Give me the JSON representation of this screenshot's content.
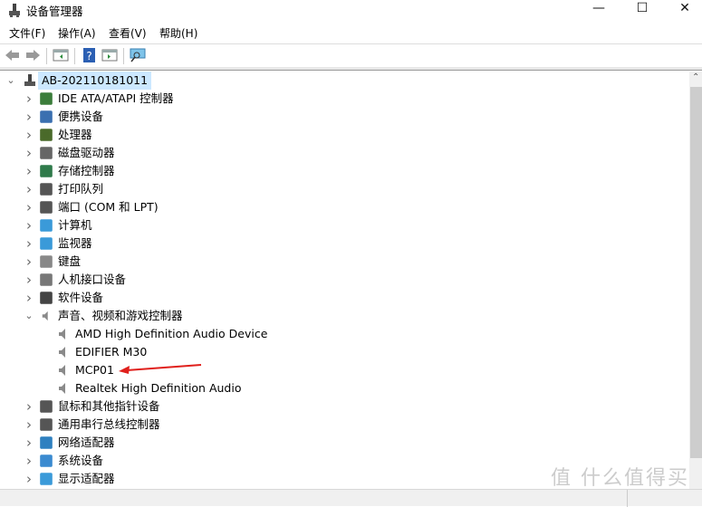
{
  "window": {
    "title": "设备管理器",
    "minimize": "—",
    "maximize": "☐",
    "close": "✕"
  },
  "menu": [
    "文件(F)",
    "操作(A)",
    "查看(V)",
    "帮助(H)"
  ],
  "toolbar": [
    "back-icon",
    "forward-icon",
    "show-hide-console-tree-icon",
    "help-icon",
    "action-pane-icon",
    "scan-hardware-icon"
  ],
  "tree": {
    "root": "AB-202110181011",
    "categories": [
      {
        "label": "IDE ATA/ATAPI 控制器",
        "icon": "ide-controller-icon"
      },
      {
        "label": "便携设备",
        "icon": "portable-device-icon"
      },
      {
        "label": "处理器",
        "icon": "processor-icon"
      },
      {
        "label": "磁盘驱动器",
        "icon": "disk-drive-icon"
      },
      {
        "label": "存储控制器",
        "icon": "storage-controller-icon"
      },
      {
        "label": "打印队列",
        "icon": "printer-icon"
      },
      {
        "label": "端口 (COM 和 LPT)",
        "icon": "port-icon"
      },
      {
        "label": "计算机",
        "icon": "computer-icon"
      },
      {
        "label": "监视器",
        "icon": "monitor-icon"
      },
      {
        "label": "键盘",
        "icon": "keyboard-icon"
      },
      {
        "label": "人机接口设备",
        "icon": "hid-icon"
      },
      {
        "label": "软件设备",
        "icon": "software-device-icon"
      },
      {
        "label": "声音、视频和游戏控制器",
        "icon": "speaker-icon",
        "expanded": true,
        "children": [
          "AMD High Definition Audio Device",
          "EDIFIER M30",
          "MCP01",
          "Realtek High Definition Audio"
        ]
      },
      {
        "label": "鼠标和其他指针设备",
        "icon": "mouse-icon"
      },
      {
        "label": "通用串行总线控制器",
        "icon": "usb-icon"
      },
      {
        "label": "网络适配器",
        "icon": "network-adapter-icon"
      },
      {
        "label": "系统设备",
        "icon": "system-device-icon"
      },
      {
        "label": "显示适配器",
        "icon": "display-adapter-icon"
      }
    ]
  },
  "annotation_color": "#e0201c",
  "watermark": "值 什么值得买"
}
